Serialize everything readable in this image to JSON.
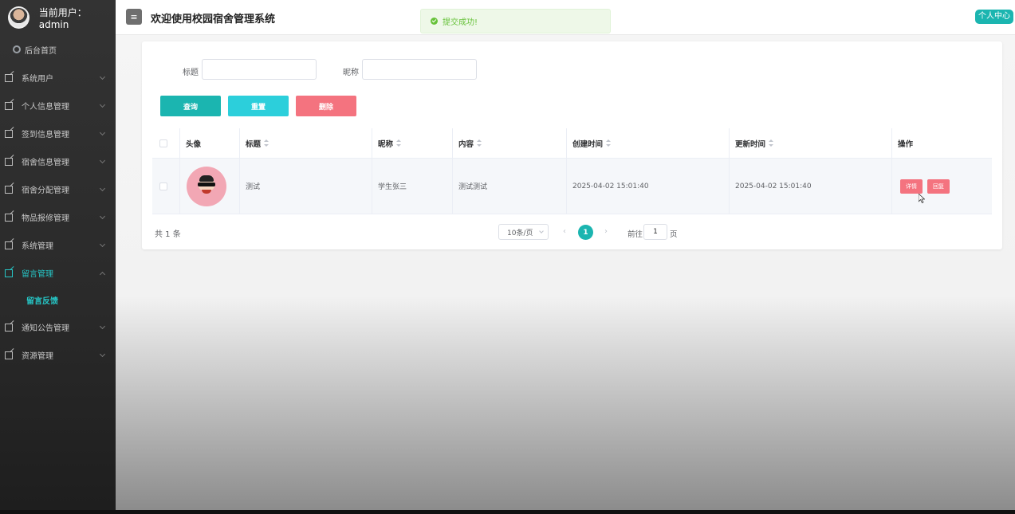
{
  "user": {
    "label": "当前用户：  admin"
  },
  "header": {
    "title": "欢迎使用校园宿舍管理系统",
    "menu_icon": "hamburger-icon",
    "profile": "个人中心"
  },
  "toast": {
    "message": "提交成功!",
    "color": "#67c23a"
  },
  "sidebar": {
    "home": "后台首页",
    "items": [
      {
        "label": "系统用户"
      },
      {
        "label": "个人信息管理"
      },
      {
        "label": "签到信息管理"
      },
      {
        "label": "宿舍信息管理"
      },
      {
        "label": "宿舍分配管理"
      },
      {
        "label": "物品报修管理"
      },
      {
        "label": "系统管理"
      },
      {
        "label": "留言管理",
        "open": true,
        "children": [
          {
            "label": "留言反馈"
          }
        ]
      },
      {
        "label": "通知公告管理"
      },
      {
        "label": "资源管理"
      }
    ]
  },
  "search": {
    "title_label": "标题",
    "title_value": "",
    "nickname_label": "昵称",
    "nickname_value": "",
    "query_button": "查询",
    "reset_button": "重置",
    "delete_button": "删除"
  },
  "table": {
    "columns": [
      "头像",
      "标题",
      "昵称",
      "内容",
      "创建时间",
      "更新时间",
      "操作"
    ],
    "rows": [
      {
        "title": "测试",
        "nickname": "学生张三",
        "content": "测试测试",
        "created": "2025-04-02 15:01:40",
        "updated": "2025-04-02 15:01:40",
        "detail_button": "详情",
        "reply_button": "回复"
      }
    ]
  },
  "pagination": {
    "total": "共 1 条",
    "page_size": "10条/页",
    "prev": "‹",
    "next": "›",
    "current_page": "1",
    "goto_label": "前往",
    "goto_value": "1",
    "goto_suffix": "页"
  },
  "colors": {
    "accent": "#1bb5b0",
    "danger": "#f4737f",
    "reset": "#2ccfdb",
    "sidebar_active": "#26c6c6"
  }
}
